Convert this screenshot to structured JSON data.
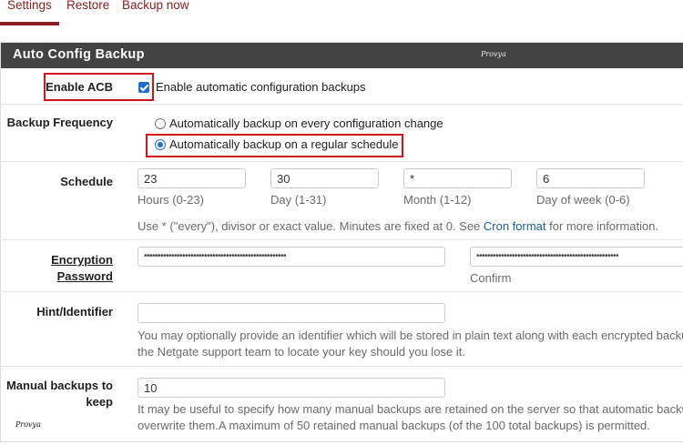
{
  "tabs": [
    {
      "label": "Settings",
      "active": true
    },
    {
      "label": "Restore",
      "active": false
    },
    {
      "label": "Backup now",
      "active": false
    }
  ],
  "panel": {
    "title": "Auto Config Backup",
    "watermark": "Provya"
  },
  "enable_acb": {
    "label": "Enable ACB",
    "checked": true,
    "checkbox_label": "Enable automatic configuration backups"
  },
  "backup_frequency": {
    "label": "Backup Frequency",
    "options": [
      {
        "label": "Automatically backup on every configuration change",
        "selected": false
      },
      {
        "label": "Automatically backup on a regular schedule",
        "selected": true
      }
    ]
  },
  "schedule": {
    "label": "Schedule",
    "fields": [
      {
        "value": "23",
        "caption": "Hours (0-23)"
      },
      {
        "value": "30",
        "caption": "Day (1-31)"
      },
      {
        "value": "*",
        "caption": "Month (1-12)"
      },
      {
        "value": "6",
        "caption": "Day of week (0-6)"
      }
    ],
    "help_prefix": "Use * (\"every\"), divisor or exact value. Minutes are fixed at 0. See ",
    "help_link": "Cron format",
    "help_suffix": " for more information."
  },
  "encryption": {
    "label_line1": "Encryption",
    "label_line2": "Password",
    "password_mask": "••••••••••••••••••••••••••••••••••••••••••••••••••••",
    "confirm_mask": "••••••••••••••••••••••••••••••••••••••••••••••••••••",
    "confirm_caption": "Confirm"
  },
  "hint": {
    "label": "Hint/Identifier",
    "value": "",
    "help_line1": "You may optionally provide an identifier which will be stored in plain text along with each encrypted backup",
    "help_line2": "the Netgate support team to locate your key should you lose it."
  },
  "manual_backups": {
    "label_line1": "Manual backups to",
    "label_line2": "keep",
    "value": "10",
    "help_line1": "It may be useful to specify how many manual backups are retained on the server so that automatic backup",
    "help_line2": "overwrite them.A maximum of 50 retained manual backups (of the 100 total backups) is permitted."
  },
  "footer_watermark": "Provya",
  "colors": {
    "accent": "#8b1d24",
    "header_bg": "#424242",
    "highlight": "#d3121c",
    "link": "#1a5fa0",
    "control": "#1f6fd1"
  }
}
